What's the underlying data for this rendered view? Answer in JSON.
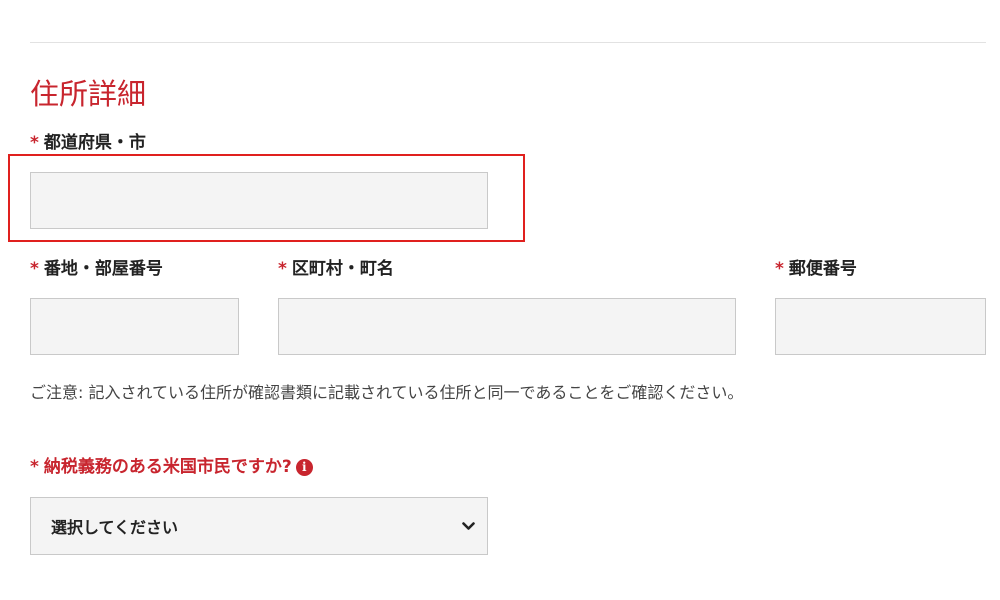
{
  "section": {
    "title": "住所詳細"
  },
  "required_mark": "*",
  "fields": {
    "prefecture_city": {
      "label": "都道府県・市",
      "value": ""
    },
    "address_room": {
      "label": "番地・部屋番号",
      "value": ""
    },
    "ward_town": {
      "label": "区町村・町名",
      "value": ""
    },
    "postal_code": {
      "label": "郵便番号",
      "value": ""
    }
  },
  "note": "ご注意: 記入されている住所が確認書類に記載されている住所と同一であることをご確認ください。",
  "tax_question": {
    "label": "納税義務のある米国市民ですか?",
    "info_icon": "i",
    "selected": "選択してください"
  },
  "colors": {
    "accent": "#c8252e",
    "highlight": "#e0201e",
    "field_bg": "#f4f4f4"
  }
}
